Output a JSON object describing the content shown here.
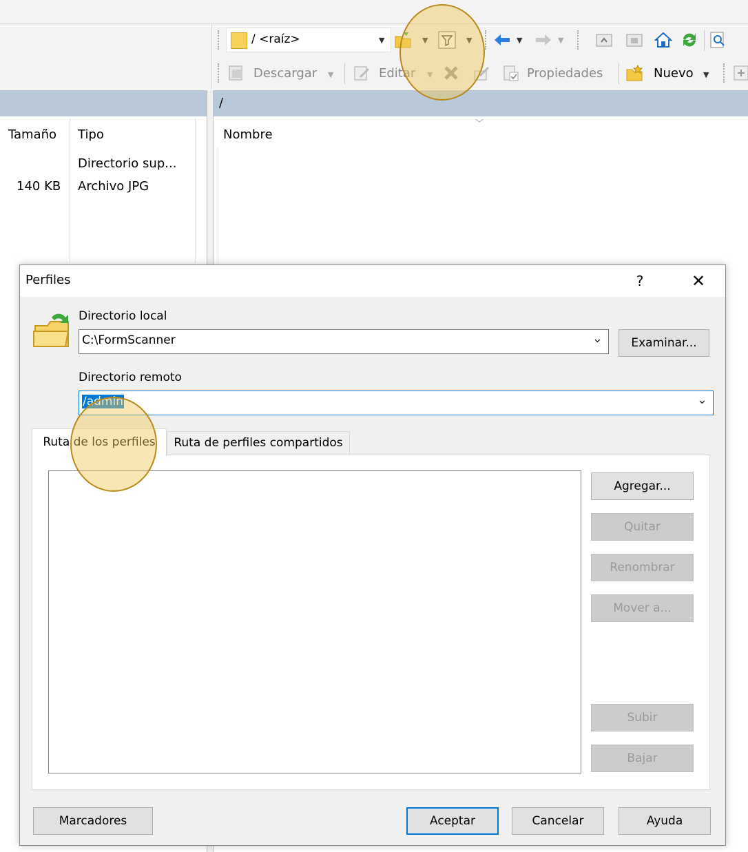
{
  "toolbar": {
    "path": "/ <raíz>",
    "download_label": "Descargar",
    "edit_label": "Editar",
    "properties_label": "Propiedades",
    "new_label": "Nuevo"
  },
  "remote_pane": {
    "path": "/",
    "column_name": "Nombre"
  },
  "local_pane": {
    "columns": [
      "Tamaño",
      "Tipo"
    ],
    "rows": [
      {
        "size": "",
        "type": "Directorio sup..."
      },
      {
        "size": "140 KB",
        "type": "Archivo JPG"
      }
    ]
  },
  "dialog": {
    "title": "Perfiles",
    "help": "?",
    "close": "✕",
    "local_dir_label": "Directorio local",
    "local_dir_value": "C:\\FormScanner",
    "browse_button": "Examinar...",
    "remote_dir_label": "Directorio remoto",
    "remote_dir_value": "/admin",
    "tabs": [
      "Ruta de los perfiles",
      "Ruta de perfiles compartidos"
    ],
    "buttons": {
      "add": "Agregar...",
      "remove": "Quitar",
      "rename": "Renombrar",
      "move": "Mover a...",
      "up": "Subir",
      "down": "Bajar"
    },
    "footer": {
      "bookmarks": "Marcadores",
      "ok": "Aceptar",
      "cancel": "Cancelar",
      "help": "Ayuda"
    }
  }
}
